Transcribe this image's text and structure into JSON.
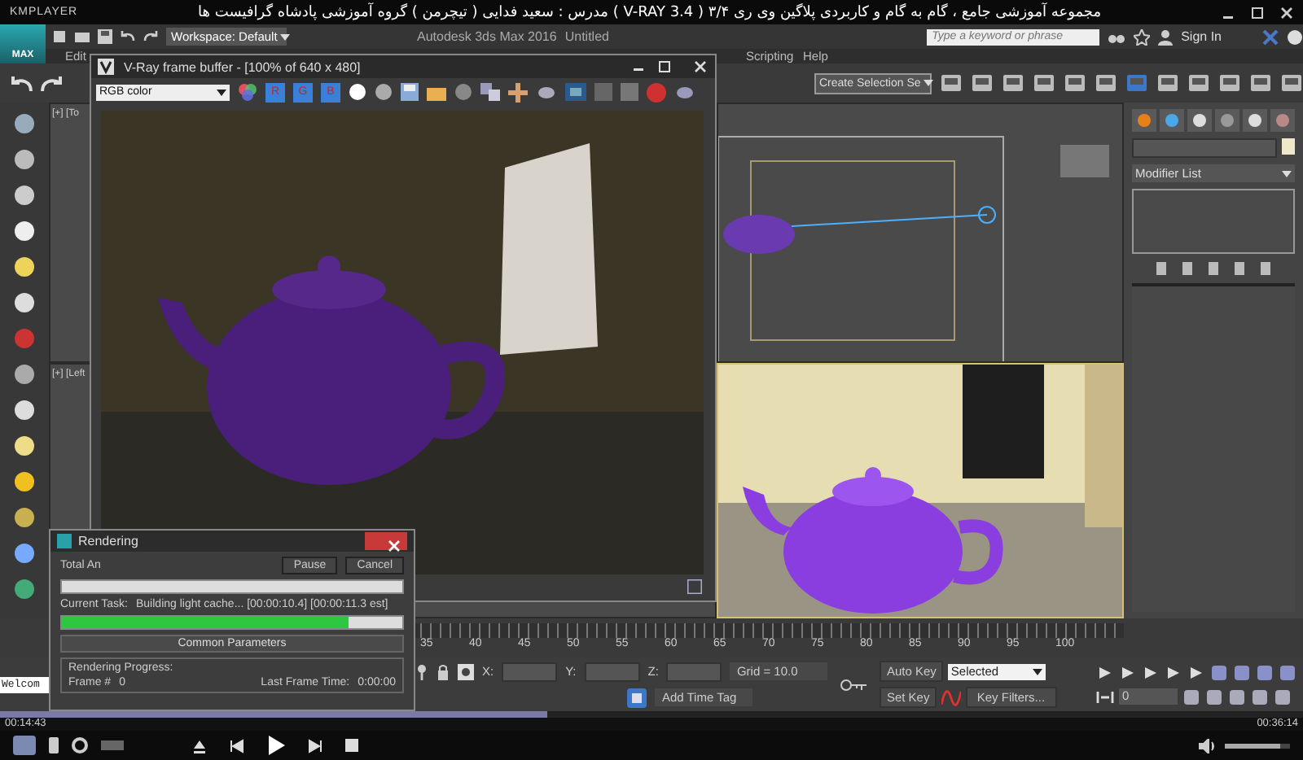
{
  "player": {
    "brand": "KMPLAYER",
    "title": "مجموعه آموزشی جامع ، گام به گام و کاربردی پلاگین وی ری ۳/۴ ( V-RAY 3.4 )  مدرس : سعید فدایی ( تیچرمن ) گروه آموزشی پادشاه گرافیست ها",
    "time_elapsed": "00:14:43",
    "time_total": "00:36:14",
    "seek": {
      "level": 0.42
    },
    "volume": {
      "level": 0.85
    }
  },
  "app": {
    "logo": "MAX",
    "workspace": "Workspace: Default",
    "title": "Autodesk 3ds Max 2016",
    "document": "Untitled",
    "search": {
      "placeholder": "Type a keyword or phrase"
    },
    "sign_in": "Sign In"
  },
  "menu": [
    "Edit",
    "Scripting",
    "Help"
  ],
  "toolbar": {
    "selection_set": "Create Selection Se"
  },
  "viewports": [
    {
      "label": "[+] [To"
    },
    {
      "label": "[+] [Left"
    }
  ],
  "command_panel": {
    "modifier_list": "Modifier List"
  },
  "frame_buffer": {
    "title": "V-Ray frame buffer - [100% of 640 x 480]",
    "channel": "RGB color",
    "channels": [
      {
        "label": "R",
        "on": true
      },
      {
        "label": "G",
        "on": true
      },
      {
        "label": "B",
        "on": true
      }
    ]
  },
  "render_dialog": {
    "title": "Rendering",
    "total_label": "Total An",
    "buttons": [
      "Pause",
      "Cancel"
    ],
    "total_progress": {
      "level": 0
    },
    "task_label": "Current Task:",
    "task": "Building light cache... [00:00:10.4] [00:00:11.3 est]",
    "task_progress": {
      "level": 0.84
    },
    "rollout": "Common Parameters",
    "group": "Rendering Progress:",
    "frame_label": "Frame #",
    "frame": "0",
    "last_frame_label": "Last Frame Time:",
    "last_frame": "0:00:00"
  },
  "timeline": {
    "ticks": [
      "35",
      "40",
      "45",
      "50",
      "55",
      "60",
      "65",
      "70",
      "75",
      "80",
      "85",
      "90",
      "95",
      "100"
    ]
  },
  "status": {
    "coords": [
      "X:",
      "Y:",
      "Z:"
    ],
    "grid": "Grid = 10.0",
    "time_tag": "Add Time Tag",
    "auto_key": "Auto Key",
    "key_mode": "Selected",
    "set_key": "Set Key",
    "key_filters": "Key Filters...",
    "frame": "0"
  },
  "listener": "Welcom"
}
